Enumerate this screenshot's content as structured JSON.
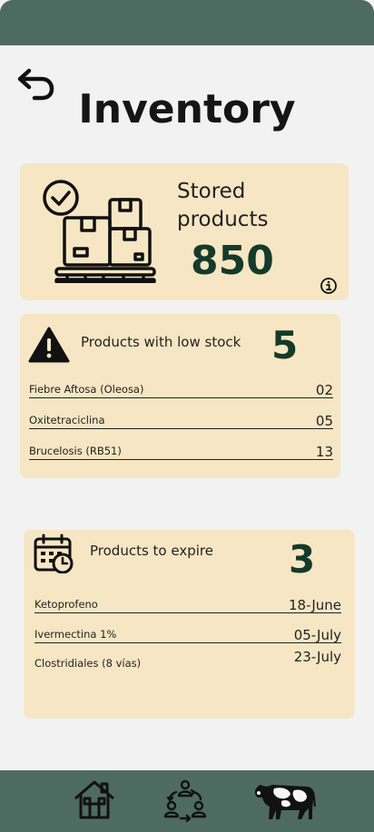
{
  "page": {
    "title": "Inventory",
    "colors": {
      "bar": "#4e6b62",
      "card": "#f6e6c3",
      "accent": "#143a2a",
      "background": "#f2f2f2"
    }
  },
  "stored": {
    "label": "Stored products",
    "value": "850",
    "icon": "warehouse-boxes-icon"
  },
  "low_stock": {
    "label": "Products with low stock",
    "count": "5",
    "icon": "warning-icon",
    "items": [
      {
        "name": "Fiebre Aftosa (Oleosa)",
        "qty": "02"
      },
      {
        "name": "Oxitetraciclina",
        "qty": "05"
      },
      {
        "name": "Brucelosis (RB51)",
        "qty": "13"
      }
    ]
  },
  "expire": {
    "label": "Products to expire",
    "count": "3",
    "icon": "calendar-clock-icon",
    "items": [
      {
        "name": "Ketoprofeno",
        "date": "18-June"
      },
      {
        "name": "Ivermectina 1%",
        "date": "05-July"
      },
      {
        "name": "Clostridiales (8 vías)",
        "date": "23-July"
      }
    ]
  },
  "nav": {
    "items": [
      {
        "icon": "home-icon"
      },
      {
        "icon": "people-exchange-icon"
      },
      {
        "icon": "cow-icon"
      }
    ]
  }
}
